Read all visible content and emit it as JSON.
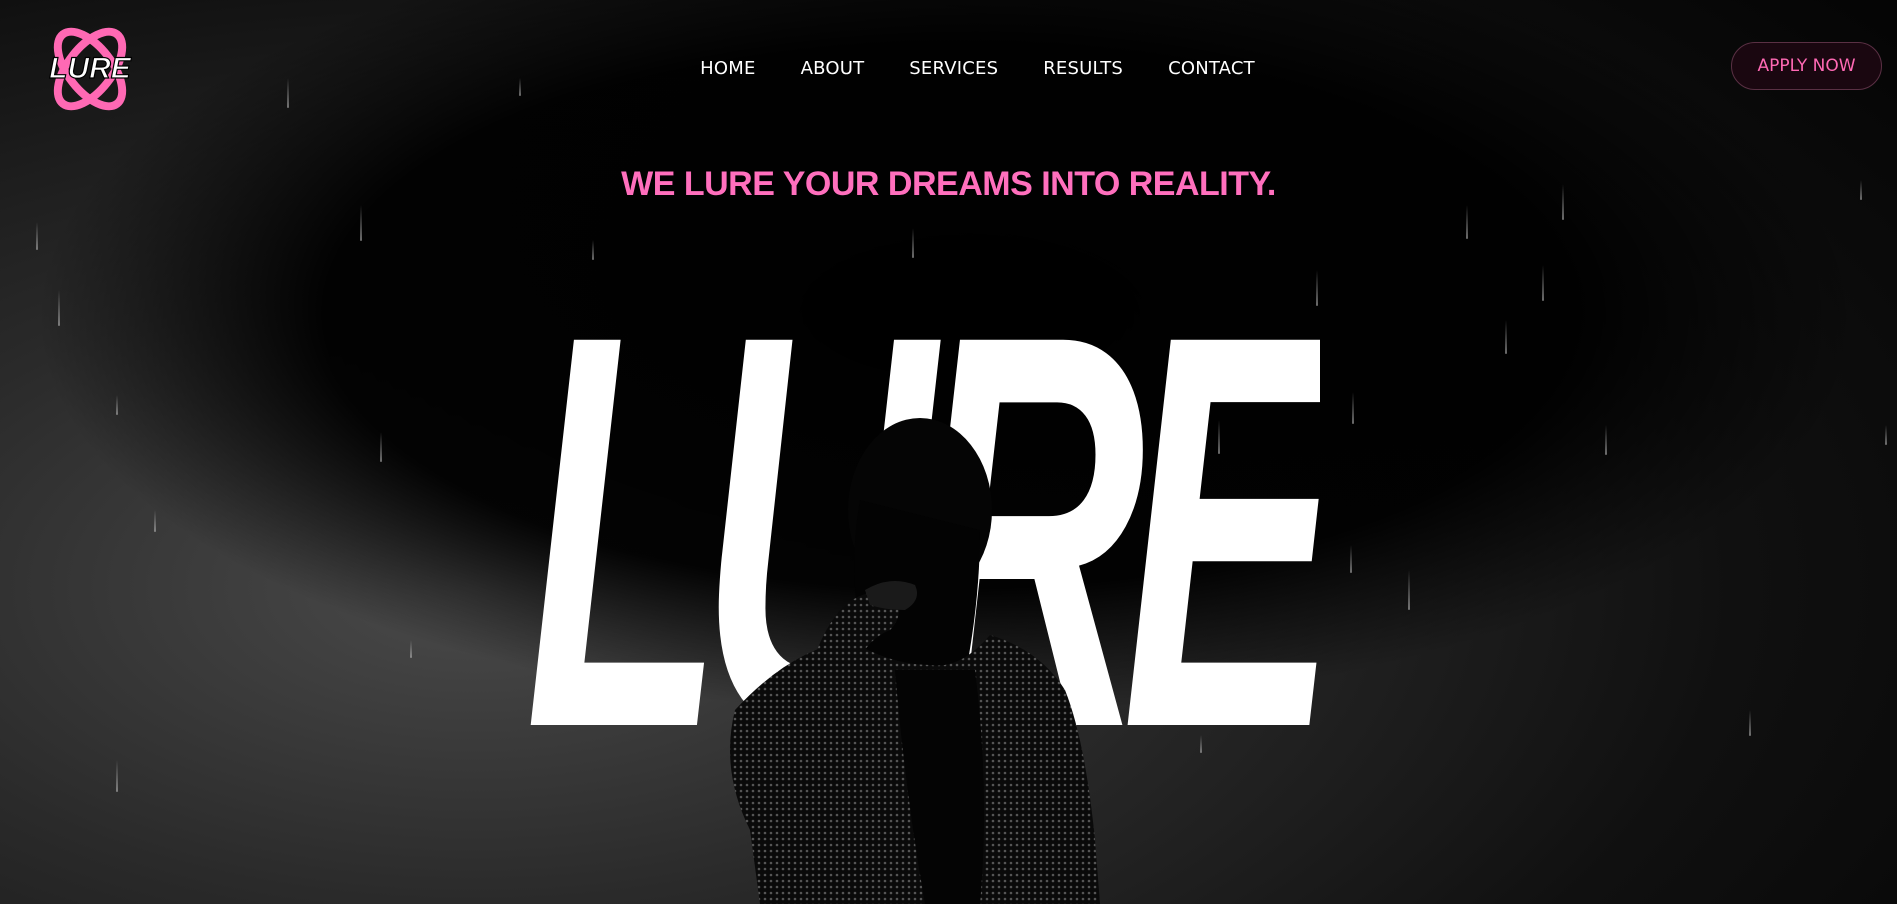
{
  "brand": {
    "logo_text": "LURE",
    "accent_color": "#ff69b4"
  },
  "nav": {
    "items": [
      {
        "label": "HOME"
      },
      {
        "label": "ABOUT"
      },
      {
        "label": "SERVICES"
      },
      {
        "label": "RESULTS"
      },
      {
        "label": "CONTACT"
      }
    ]
  },
  "cta": {
    "apply_label": "APPLY NOW"
  },
  "hero": {
    "tagline": "WE LURE YOUR DREAMS INTO REALITY.",
    "big_word": "LURE",
    "figure_icon": "silhouette-woman-icon"
  }
}
